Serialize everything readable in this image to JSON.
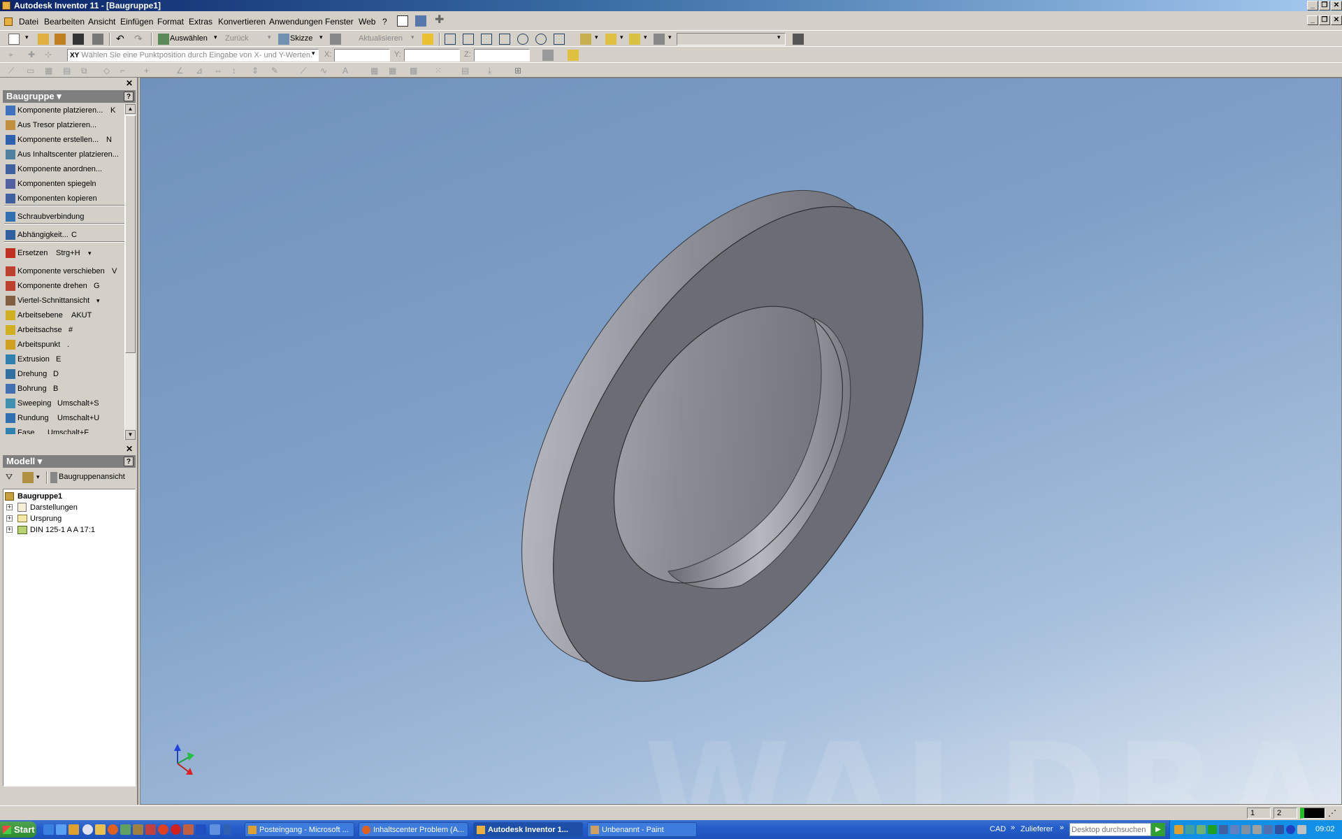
{
  "window": {
    "title": "Autodesk Inventor 11 - [Baugruppe1]"
  },
  "menu": [
    "Datei",
    "Bearbeiten",
    "Ansicht",
    "Einfügen",
    "Format",
    "Extras",
    "Konvertieren",
    "Anwendungen",
    "Fenster",
    "Web",
    "?"
  ],
  "toolbar": {
    "select_label": "Auswählen",
    "back_label": "Zurück",
    "sketch_label": "Skizze",
    "update_label": "Aktualisieren",
    "coord_hint": "Wählen Sie eine Punktposition durch Eingabe von X- und Y-Werten.",
    "coord_prefix": "XY",
    "x_label": "X:",
    "y_label": "Y:",
    "z_label": "Z:",
    "x_value": "",
    "y_value": "",
    "z_value": ""
  },
  "panel_bar": {
    "title": "Baugruppe",
    "help": "?",
    "commands": [
      {
        "label": "Komponente platzieren...",
        "shortcut": "K",
        "icon": "place-component-icon"
      },
      {
        "label": "Aus Tresor platzieren...",
        "shortcut": "",
        "icon": "place-from-vault-icon"
      },
      {
        "label": "Komponente erstellen...",
        "shortcut": "N",
        "icon": "create-component-icon"
      },
      {
        "label": "Aus Inhaltscenter platzieren...",
        "shortcut": "",
        "icon": "content-center-icon"
      },
      {
        "label": "Komponente anordnen...",
        "shortcut": "",
        "icon": "pattern-component-icon"
      },
      {
        "label": "Komponenten spiegeln",
        "shortcut": "",
        "icon": "mirror-components-icon"
      },
      {
        "label": "Komponenten kopieren",
        "shortcut": "",
        "icon": "copy-components-icon"
      },
      {
        "label": "Schraubverbindung",
        "shortcut": "",
        "icon": "bolted-connection-icon"
      },
      {
        "label": "Abhängigkeit...",
        "shortcut": "C",
        "icon": "constraint-icon"
      },
      {
        "label": "Ersetzen",
        "shortcut": "Strg+H",
        "icon": "replace-icon"
      },
      {
        "label": "Komponente verschieben",
        "shortcut": "V",
        "icon": "move-component-icon"
      },
      {
        "label": "Komponente drehen",
        "shortcut": "G",
        "icon": "rotate-component-icon"
      },
      {
        "label": "Viertel-Schnittansicht",
        "shortcut": "",
        "icon": "quarter-section-icon"
      },
      {
        "label": "Arbeitsebene",
        "shortcut": "AKUT",
        "icon": "work-plane-icon"
      },
      {
        "label": "Arbeitsachse",
        "shortcut": "#",
        "icon": "work-axis-icon"
      },
      {
        "label": "Arbeitspunkt",
        "shortcut": ".",
        "icon": "work-point-icon"
      },
      {
        "label": "Extrusion",
        "shortcut": "E",
        "icon": "extrude-icon"
      },
      {
        "label": "Drehung",
        "shortcut": "D",
        "icon": "revolve-icon"
      },
      {
        "label": "Bohrung",
        "shortcut": "B",
        "icon": "hole-icon"
      },
      {
        "label": "Sweeping",
        "shortcut": "Umschalt+S",
        "icon": "sweep-icon"
      },
      {
        "label": "Rundung",
        "shortcut": "Umschalt+U",
        "icon": "fillet-icon"
      },
      {
        "label": "Fase",
        "shortcut": "Umschalt+F",
        "icon": "chamfer-icon"
      }
    ]
  },
  "browser": {
    "title": "Modell",
    "help": "?",
    "view_label": "Baugruppenansicht",
    "root": "Baugruppe1",
    "nodes": [
      "Darstellungen",
      "Ursprung",
      "DIN 125-1 A A 17:1"
    ]
  },
  "viewport": {
    "watermark": "WALDRAFF"
  },
  "statusbar": {
    "field1": "1",
    "field2": "2"
  },
  "taskbar": {
    "start_label": "Start",
    "tasks": [
      {
        "label": "Posteingang - Microsoft ...",
        "active": false
      },
      {
        "label": "Inhaltscenter Problem (A...",
        "active": false
      },
      {
        "label": "Autodesk Inventor 1...",
        "active": true
      },
      {
        "label": "Unbenannt - Paint",
        "active": false
      }
    ],
    "toolbar_cad": "CAD",
    "toolbar_zulieferer": "Zulieferer",
    "search_placeholder": "Desktop durchsuchen",
    "clock": "09:02"
  }
}
